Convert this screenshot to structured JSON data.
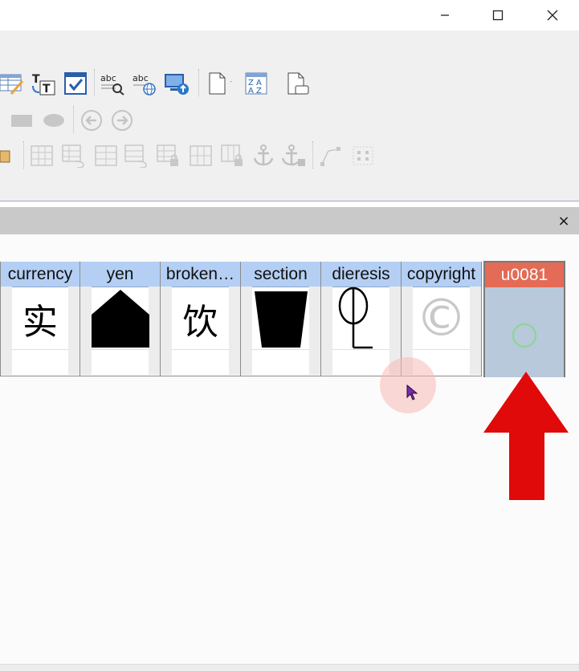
{
  "window": {
    "controls": [
      "minimize-icon",
      "maximize-icon",
      "close-icon"
    ]
  },
  "toolbar": {
    "row1": [
      "table-edit-icon",
      "text-direction-icon",
      "checkbox-icon",
      "spellcheck-icon",
      "spellcheck-web-icon",
      "monitor-upload-icon",
      "new-document-icon",
      "sort-az-icon",
      "page-options-icon"
    ],
    "row2": [
      "rectangle-icon",
      "ellipse-icon",
      "arrow-left-icon",
      "arrow-right-icon"
    ],
    "row3": [
      "grid-icon",
      "grid-undo-icon",
      "grid-rows-icon",
      "grid-rows-undo-icon",
      "grid-lock-icon",
      "grid-columns-icon",
      "grid-columns-lock-icon",
      "anchor-icon",
      "anchor-lock-icon",
      "curve-edit-icon",
      "select-points-icon"
    ]
  },
  "panel": {
    "close_glyph": "×"
  },
  "glyphs": [
    {
      "name": "currency",
      "char": "实"
    },
    {
      "name": "yen",
      "char": ""
    },
    {
      "name": "broken…",
      "char": "饮"
    },
    {
      "name": "section",
      "char": ""
    },
    {
      "name": "dieresis",
      "char": ""
    },
    {
      "name": "copyright",
      "char": "©"
    },
    {
      "name": "u0081",
      "char": ""
    }
  ],
  "colors": {
    "header_blue": "#b4cff3",
    "selected_header": "#e46b55",
    "selected_body": "#b9c9dc",
    "arrow_red": "#e00a0a",
    "toolbar_bg": "#f0f0f0"
  }
}
